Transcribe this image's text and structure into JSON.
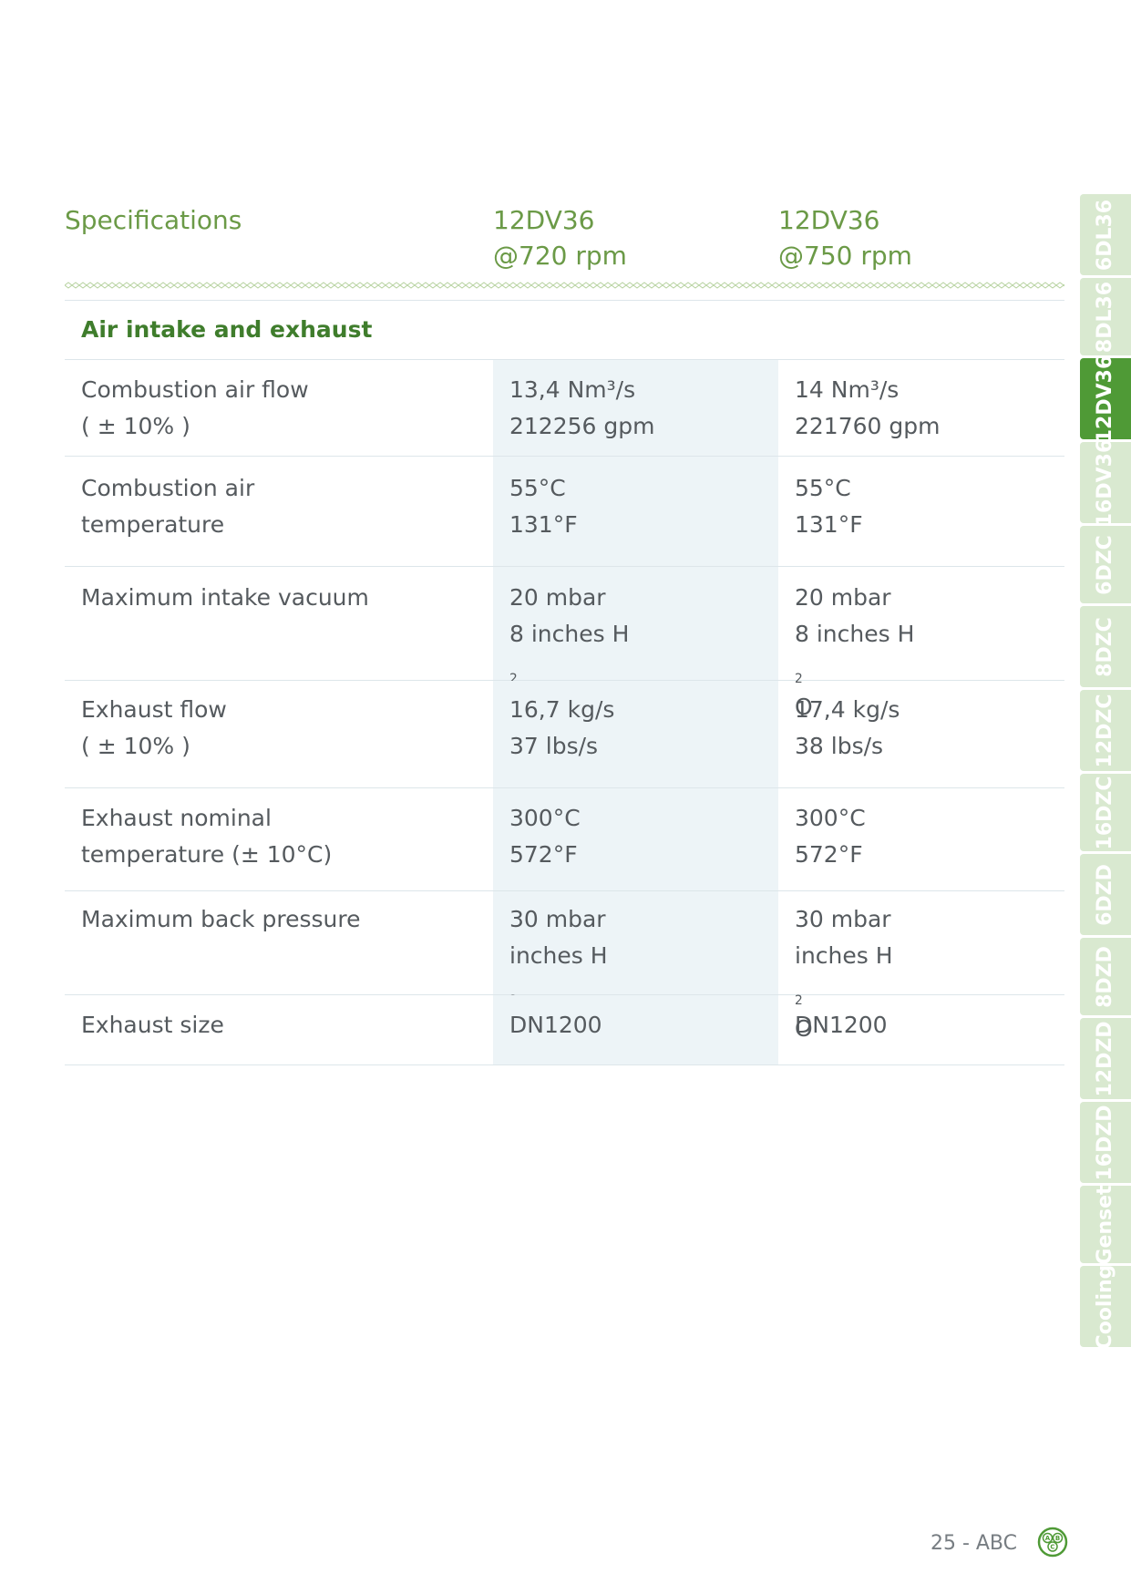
{
  "header": {
    "title": "Specifications",
    "col1_line1": "12DV36",
    "col1_line2": "@720 rpm",
    "col2_line1": "12DV36",
    "col2_line2": "@750 rpm"
  },
  "section": "Air intake and exhaust",
  "rows": [
    {
      "label": [
        "Combustion air flow",
        "( ± 10% )"
      ],
      "v1": [
        "13,4 Nm³/s",
        "212256 gpm"
      ],
      "v2": [
        "14 Nm³/s",
        "221760 gpm"
      ]
    },
    {
      "label": [
        "Combustion air",
        "temperature"
      ],
      "v1": [
        "55°C",
        "131°F"
      ],
      "v2": [
        "55°C",
        "131°F"
      ]
    },
    {
      "label": [
        "Maximum intake vacuum"
      ],
      "v1": [
        "20 mbar",
        "8 inches H"
      ],
      "v2": [
        "20 mbar",
        "8 inches H"
      ]
    },
    {
      "label": [
        "Exhaust flow",
        "( ± 10% )"
      ],
      "v1": [
        "16,7 kg/s",
        "37 lbs/s"
      ],
      "v2": [
        "17,4 kg/s",
        "38 lbs/s"
      ]
    },
    {
      "label": [
        "Exhaust nominal",
        "temperature (± 10°C)"
      ],
      "v1": [
        "300°C",
        "572°F"
      ],
      "v2": [
        "300°C",
        "572°F"
      ]
    },
    {
      "label": [
        "Maximum back pressure"
      ],
      "v1": [
        "30 mbar",
        "inches H"
      ],
      "v2": [
        "30 mbar",
        "inches H"
      ]
    },
    {
      "label": [
        "Exhaust size"
      ],
      "v1": [
        "DN1200"
      ],
      "v2": [
        "DN1200"
      ]
    }
  ],
  "h2o": {
    "sub": "2",
    "tail": "O"
  },
  "tabs": [
    "6DL36",
    "8DL36",
    "12DV36",
    "16DV36",
    "6DZC",
    "8DZC",
    "12DZC",
    "16DZC",
    "6DZD",
    "8DZD",
    "12DZD",
    "16DZD",
    "Genset",
    "Cooling"
  ],
  "active_tab": "12DV36",
  "footer": {
    "page": "25 - ABC",
    "logo_letters": [
      "A",
      "B",
      "C"
    ]
  },
  "colors": {
    "accent": "#6b9a47",
    "section": "#3f7d2c",
    "active_tab": "#4f9a36",
    "inactive_tab": "#d9e9d0",
    "column_shade": "#edf4f7"
  }
}
